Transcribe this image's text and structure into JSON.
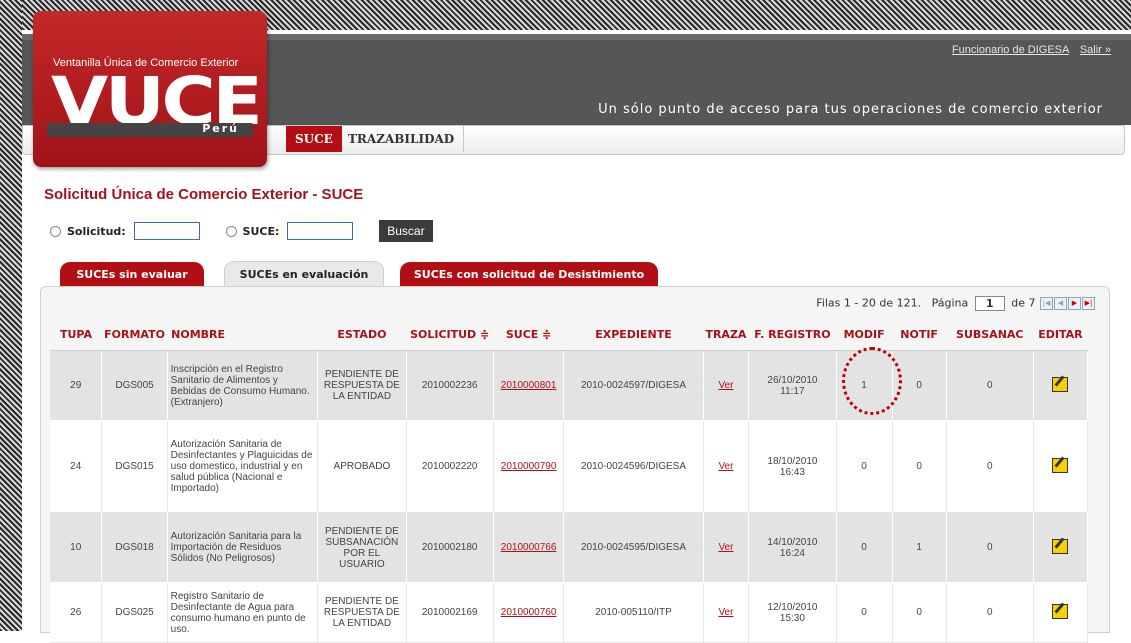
{
  "header": {
    "user_link": "Funcionario de DIGESA",
    "logout_link": "Salir »",
    "tagline": "Un sólo punto de acceso para tus operaciones de comercio exterior"
  },
  "logo": {
    "subtitle": "Ventanilla Única de Comercio Exterior",
    "word": "VUCE",
    "country": "Perú"
  },
  "nav": {
    "tab1": "SUCE",
    "tab2": "TRAZABILIDAD"
  },
  "page_title": "Solicitud Única de Comercio Exterior - SUCE",
  "search": {
    "solicitud_label": "Solicitud:",
    "suce_label": "SUCE:",
    "button": "Buscar"
  },
  "tabs": {
    "sin_evaluar": "SUCEs sin evaluar",
    "en_evaluacion": "SUCEs en evaluación",
    "desistimiento": "SUCEs con solicitud de Desistimiento"
  },
  "pager": {
    "rows_text": "Filas 1 - 20 de 121.",
    "page_label": "Página",
    "page_value": "1",
    "of_text": "de 7"
  },
  "table": {
    "headers": {
      "tupa": "TUPA",
      "formato": "FORMATO",
      "nombre": "NOMBRE",
      "estado": "ESTADO",
      "solicitud": "SOLICITUD ≑",
      "suce": "SUCE ≑",
      "expediente": "EXPEDIENTE",
      "traza": "TRAZA",
      "registro": "F. REGISTRO",
      "modif": "MODIF",
      "notif": "NOTIF",
      "subsanac": "SUBSANAC",
      "editar": "EDITAR"
    },
    "rows": [
      {
        "tupa": "29",
        "formato": "DGS005",
        "nombre": "Inscripción en el Registro Sanitario de Alimentos y Bebidas de Consumo Humano. (Extranjero)",
        "estado": "PENDIENTE DE RESPUESTA DE LA ENTIDAD",
        "solicitud": "2010002236",
        "suce": "2010000801",
        "expediente": "2010-0024597/DIGESA",
        "traza": "Ver",
        "registro_date": "26/10/2010",
        "registro_time": "11:17",
        "modif": "1",
        "notif": "0",
        "subsanac": "0"
      },
      {
        "tupa": "24",
        "formato": "DGS015",
        "nombre": "Autorización Sanitaria de Desinfectantes y Plaguicidas de uso domestico, industrial y en salud pública (Nacional e Importado)",
        "estado": "APROBADO",
        "solicitud": "2010002220",
        "suce": "2010000790",
        "expediente": "2010-0024596/DIGESA",
        "traza": "Ver",
        "registro_date": "18/10/2010",
        "registro_time": "16:43",
        "modif": "0",
        "notif": "0",
        "subsanac": "0"
      },
      {
        "tupa": "10",
        "formato": "DGS018",
        "nombre": "Autorización Sanitaria para la Importación de Residuos Sólidos (No Peligrosos)",
        "estado": "PENDIENTE DE SUBSANACIÓN POR EL USUARIO",
        "solicitud": "2010002180",
        "suce": "2010000766",
        "expediente": "2010-0024595/DIGESA",
        "traza": "Ver",
        "registro_date": "14/10/2010",
        "registro_time": "16:24",
        "modif": "0",
        "notif": "1",
        "subsanac": "0"
      },
      {
        "tupa": "26",
        "formato": "DGS025",
        "nombre": "Registro Sanitario de Desinfectante de Agua para consumo humano en punto de uso.",
        "estado": "PENDIENTE DE RESPUESTA DE LA ENTIDAD",
        "solicitud": "2010002169",
        "suce": "2010000760",
        "expediente": "2010-005110/ITP",
        "traza": "Ver",
        "registro_date": "12/10/2010",
        "registro_time": "15:30",
        "modif": "0",
        "notif": "0",
        "subsanac": "0"
      }
    ]
  }
}
